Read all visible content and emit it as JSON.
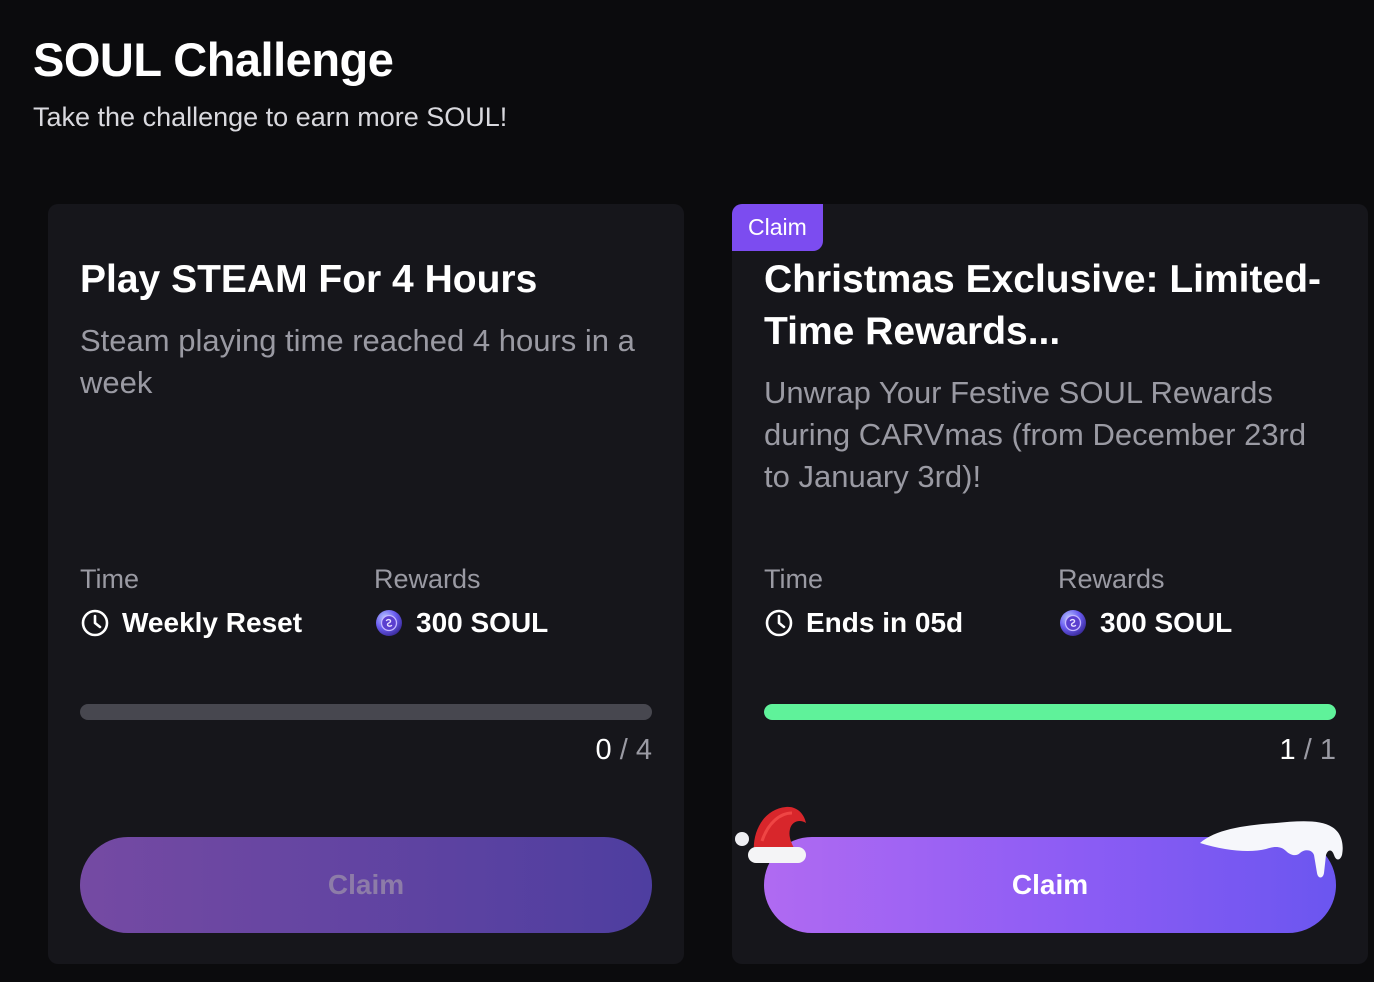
{
  "header": {
    "title": "SOUL Challenge",
    "subtitle": "Take the challenge to earn more SOUL!"
  },
  "cards": [
    {
      "title": "Play STEAM For 4 Hours",
      "description": "Steam playing time reached 4 hours in a week",
      "time_label": "Time",
      "time_value": "Weekly Reset",
      "rewards_label": "Rewards",
      "rewards_value": "300 SOUL",
      "progress_current": "0",
      "progress_separator": "/",
      "progress_total": "4",
      "progress_fraction": 0,
      "button_label": "Claim",
      "button_enabled": false
    },
    {
      "badge": "Claim",
      "title": "Christmas Exclusive: Limited-Time Rewards...",
      "description": "Unwrap Your Festive SOUL Rewards during CARVmas (from December 23rd to January 3rd)!",
      "time_label": "Time",
      "time_value": "Ends in 05d",
      "rewards_label": "Rewards",
      "rewards_value": "300 SOUL",
      "progress_current": "1",
      "progress_separator": "/",
      "progress_total": "1",
      "progress_fraction": 1,
      "button_label": "Claim",
      "button_enabled": true
    }
  ],
  "icons": {
    "time": "clock-icon",
    "reward": "soul-coin-icon",
    "decoration_1": "santa-hat-icon",
    "decoration_2": "snow-cap-decoration"
  },
  "colors": {
    "background": "#0b0b0d",
    "card": "#16161b",
    "badge": "#7c4cf0",
    "progress_complete": "#5ff29a",
    "progress_track": "#47474f",
    "button_active_start": "#b06af2",
    "button_active_end": "#6b56f0"
  }
}
